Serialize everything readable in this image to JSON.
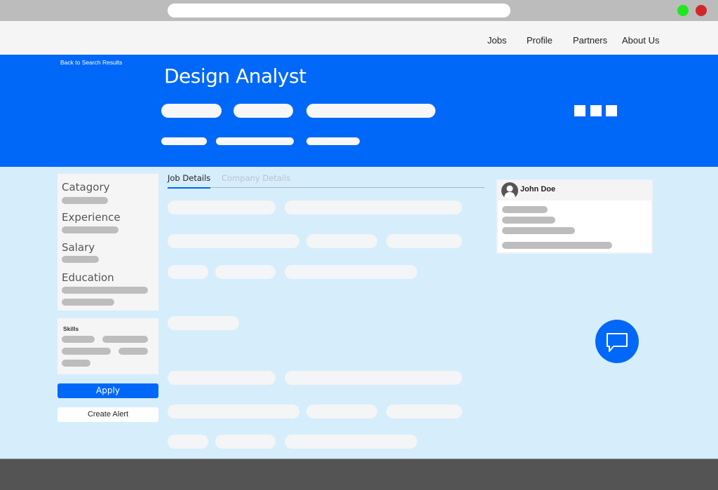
{
  "browser": {
    "url_value": "",
    "window_controls": [
      {
        "icon": "maximize-dot-icon",
        "color": "#1ee81e"
      },
      {
        "icon": "close-dot-icon",
        "color": "#d02828"
      }
    ]
  },
  "nav": {
    "items": [
      {
        "label": "Jobs"
      },
      {
        "label": "Profile"
      },
      {
        "label": "Partners"
      },
      {
        "label": "About Us"
      }
    ]
  },
  "hero": {
    "back_link": "Back to Search Results",
    "title": "Design Analyst",
    "actions_icon": "three-squares-menu-icon",
    "accent_color": "#0068f8"
  },
  "filters": {
    "sections": [
      {
        "label": "Catagory"
      },
      {
        "label": "Experience"
      },
      {
        "label": "Salary"
      },
      {
        "label": "Education"
      }
    ],
    "skills_label": "Skills"
  },
  "buttons": {
    "apply": "Apply",
    "create_alert": "Create Alert"
  },
  "tabs": {
    "items": [
      {
        "label": "Job Details",
        "active": true
      },
      {
        "label": "Company Details",
        "active": false
      }
    ]
  },
  "user_card": {
    "name": "John Doe",
    "avatar_icon": "user-avatar-icon"
  },
  "chat": {
    "icon": "chat-bubble-icon"
  }
}
